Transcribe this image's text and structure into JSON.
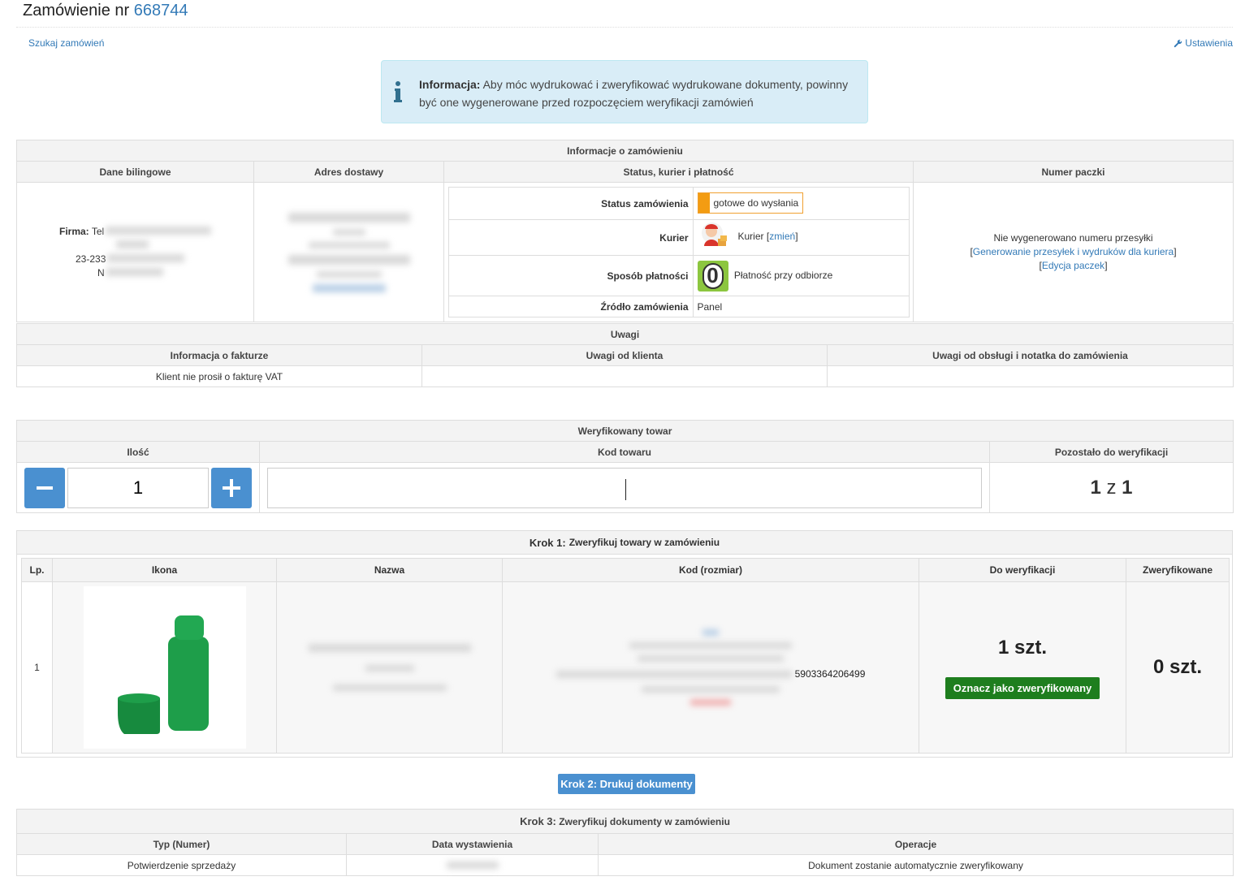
{
  "header": {
    "title_prefix": "Zamówienie nr",
    "order_number": "668744",
    "search_link": "Szukaj zamówień",
    "settings_link": "Ustawienia"
  },
  "info": {
    "label": "Informacja:",
    "text": "Aby móc wydrukować i zweryfikować wydrukowane dokumenty, powinny być one wygenerowane przed rozpoczęciem weryfikacji zamówień"
  },
  "order_info": {
    "title": "Informacje o zamówieniu",
    "col_billing": "Dane bilingowe",
    "col_delivery": "Adres dostawy",
    "col_status": "Status, kurier i płatność",
    "col_package": "Numer paczki",
    "billing": {
      "firma_label": "Firma:",
      "firma_value": "Tel",
      "postal": "23-233",
      "nip_prefix": "N"
    },
    "status_label": "Status zamówienia",
    "status_value": "gotowe do wysłania",
    "courier_label": "Kurier",
    "courier_value": "Kurier",
    "courier_change": "zmień",
    "payment_label": "Sposób płatności",
    "payment_icon_digit": "0",
    "payment_value": "Płatność przy odbiorze",
    "source_label": "Źródło zamówienia",
    "source_value": "Panel",
    "package_none": "Nie wygenerowano numeru przesyłki",
    "package_generate": "Generowanie przesyłek i wydruków dla kuriera",
    "package_edit": "Edycja paczek"
  },
  "remarks": {
    "title": "Uwagi",
    "col_invoice": "Informacja o fakturze",
    "col_client": "Uwagi od klienta",
    "col_staff": "Uwagi od obsługi i notatka do zamówienia",
    "invoice_value": "Klient nie prosił o fakturę VAT",
    "client_value": "",
    "staff_value": ""
  },
  "verify": {
    "title": "Weryfikowany towar",
    "col_qty": "Ilość",
    "col_code": "Kod towaru",
    "col_remaining": "Pozostało do weryfikacji",
    "qty_value": "1",
    "code_value": "",
    "remaining_done": "1",
    "remaining_of": "z",
    "remaining_total": "1"
  },
  "step1": {
    "title_bold": "Krok 1:",
    "title_rest": "Zweryfikuj towary w zamówieniu",
    "col_lp": "Lp.",
    "col_icon": "Ikona",
    "col_name": "Nazwa",
    "col_code": "Kod (rozmiar)",
    "col_to_verify": "Do weryfikacji",
    "col_verified": "Zweryfikowane",
    "rows": [
      {
        "lp": "1",
        "ean": "5903364206499",
        "to_verify": "1 szt.",
        "verify_button": "Oznacz jako zweryfikowany",
        "verified": "0 szt."
      }
    ]
  },
  "step2_button": "Krok 2: Drukuj dokumenty",
  "step3": {
    "title_bold": "Krok 3:",
    "title_rest": "Zweryfikuj dokumenty w zamówieniu",
    "col_type": "Typ (Numer)",
    "col_date": "Data wystawienia",
    "col_ops": "Operacje",
    "rows": [
      {
        "type": "Potwierdzenie sprzedaży",
        "operation": "Dokument zostanie automatycznie zweryfikowany"
      }
    ]
  },
  "colors": {
    "link": "#337ab7",
    "info_bg": "#d9edf7",
    "status_orange": "#f39c12",
    "payment_green": "#8cc63f",
    "verify_btn_green": "#1e7e1e",
    "step_btn_blue": "#4a90d0",
    "product_green": "#1e9e4a"
  }
}
